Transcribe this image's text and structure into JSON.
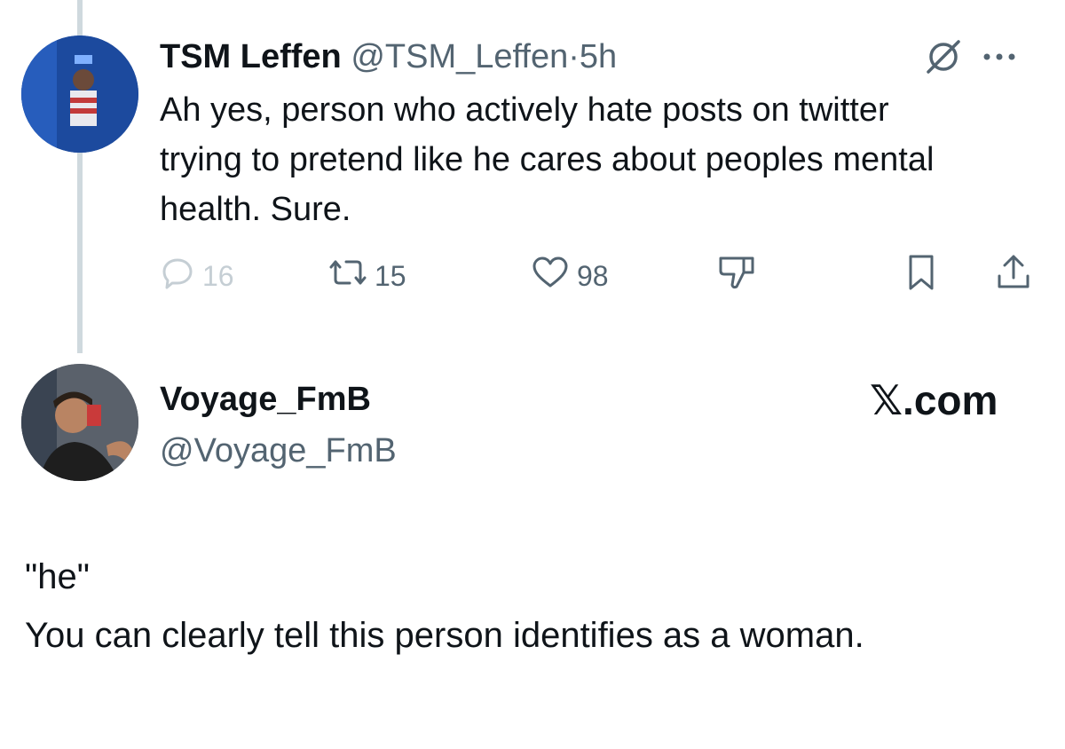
{
  "tweet1": {
    "name": "TSM Leffen",
    "handle": "@TSM_Leffen",
    "separator": "·",
    "time": "5h",
    "body": "Ah yes, person who actively hate posts on twitter trying to pretend like he cares about peoples mental health. Sure.",
    "actions": {
      "replies": "16",
      "reposts": "15",
      "likes": "98"
    }
  },
  "tweet2": {
    "name": "Voyage_FmB",
    "handle": "@Voyage_FmB",
    "brand": "𝕏.com",
    "lines": [
      "\"he\"",
      "You can clearly tell this person identifies as a woman."
    ]
  },
  "colors": {
    "text": "#0f1419",
    "secondary": "#536471",
    "thread_line": "#cfd9de"
  },
  "icons": {
    "header": [
      "mute-circle-icon",
      "more-icon"
    ],
    "actions": [
      "reply-icon",
      "repost-icon",
      "like-icon",
      "dislike-icon",
      "bookmark-icon",
      "share-icon"
    ]
  }
}
